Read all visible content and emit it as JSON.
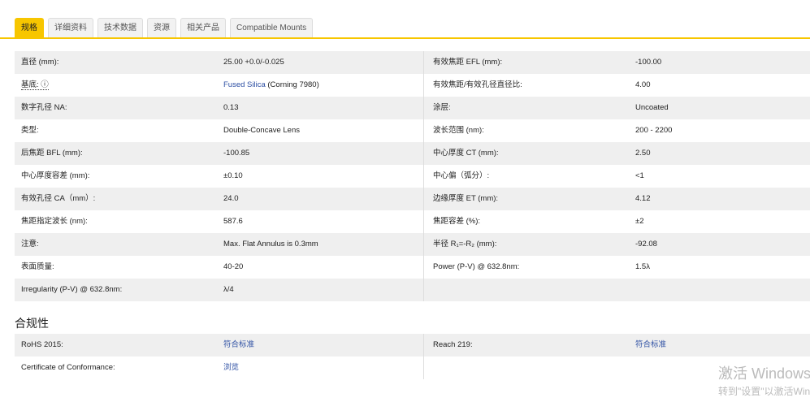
{
  "tabs": [
    "规格",
    "详细资料",
    "技术数据",
    "资源",
    "相关产品",
    "Compatible Mounts"
  ],
  "specs": [
    [
      "直径 (mm):",
      "25.00 +0.0/-0.025",
      "有效焦距 EFL (mm):",
      "-100.00"
    ],
    [
      "基底: ⓘ",
      "",
      "有效焦距/有效孔径直径比:",
      "4.00"
    ],
    [
      "数字孔径 NA:",
      "0.13",
      "涂层:",
      "Uncoated"
    ],
    [
      "类型:",
      "Double-Concave Lens",
      "波长范围 (nm):",
      "200 - 2200"
    ],
    [
      "后焦距 BFL (mm):",
      "-100.85",
      "中心厚度 CT (mm):",
      "2.50"
    ],
    [
      "中心厚度容差 (mm):",
      "±0.10",
      "中心偏（弧分）:",
      "<1"
    ],
    [
      "有效孔径 CA（mm）:",
      "24.0",
      "边缘厚度 ET (mm):",
      "4.12"
    ],
    [
      "焦距指定波长 (nm):",
      "587.6",
      "焦距容差 (%):",
      "±2"
    ],
    [
      "注意:",
      "Max. Flat Annulus is 0.3mm",
      "半径 R₁=-R₂ (mm):",
      "-92.08"
    ],
    [
      "表面质量:",
      "40-20",
      "Power (P-V) @ 632.8nm:",
      "1.5λ"
    ],
    [
      "Irregularity (P-V) @ 632.8nm:",
      "λ/4",
      "",
      ""
    ]
  ],
  "substrate": {
    "link": "Fused Silica",
    "rest": " (Corning 7980)"
  },
  "compliance": {
    "title": "合规性",
    "rows": [
      [
        "RoHS 2015:",
        "符合标准",
        "Reach 219:",
        "符合标准"
      ],
      [
        "Certificate of Conformance:",
        "浏览",
        "",
        ""
      ]
    ]
  },
  "watermark": {
    "line1": "激活 Windows",
    "line2": "转到\"设置\"以激活Windows"
  }
}
